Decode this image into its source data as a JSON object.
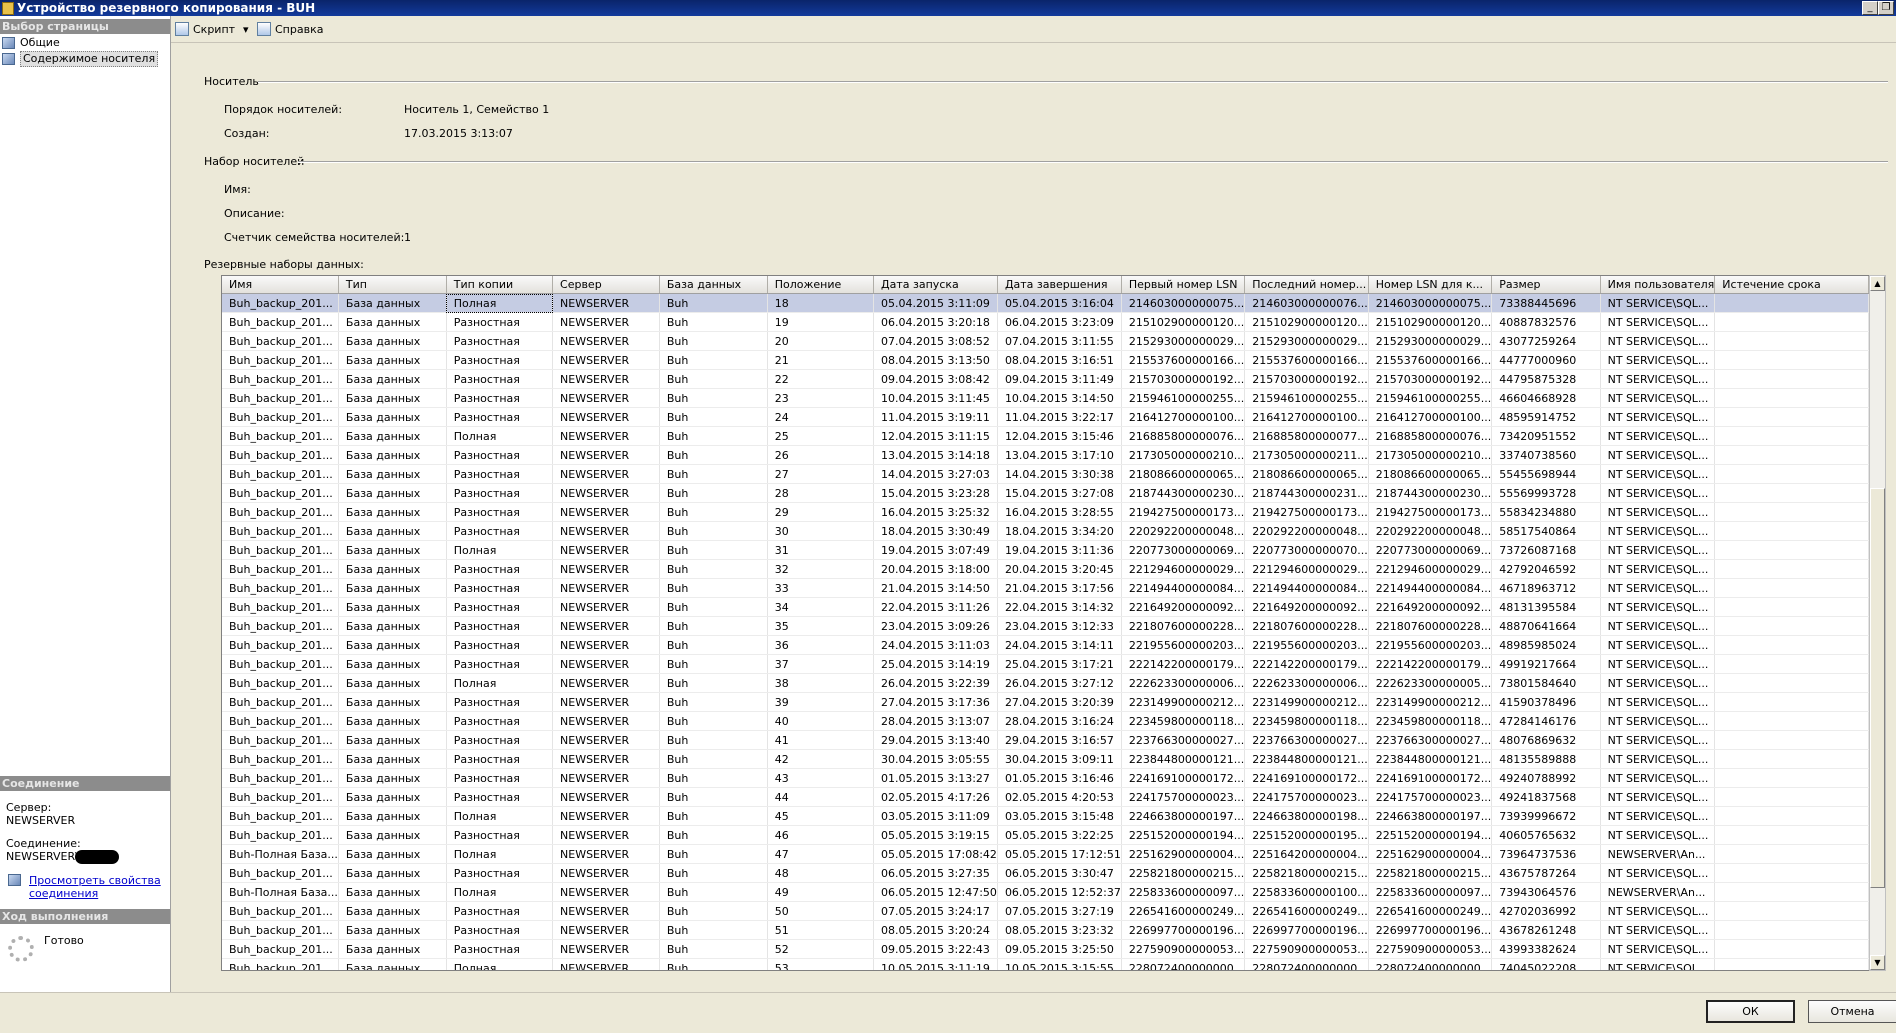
{
  "window": {
    "title": "Устройство резервного копирования - BUH",
    "minimize_glyph": "_",
    "restore_glyph": "❐"
  },
  "sidebar": {
    "page_select_header": "Выбор страницы",
    "items": [
      {
        "label": "Общие",
        "icon": "page-icon",
        "selected": false
      },
      {
        "label": "Содержимое носителя",
        "icon": "page-icon",
        "selected": true
      }
    ],
    "connection_header": "Соединение",
    "server_label": "Сервер:",
    "server_value": "NEWSERVER",
    "connection_label": "Соединение:",
    "connection_value": "NEWSERVER\\",
    "view_props_line1": "Просмотреть свойства",
    "view_props_line2": "соединения",
    "progress_header": "Ход выполнения",
    "progress_status": "Готово"
  },
  "toolbar": {
    "script_label": "Скрипт",
    "script_dropdown_glyph": "▾",
    "help_label": "Справка"
  },
  "media": {
    "section_title": "Носитель",
    "order_label": "Порядок носителей:",
    "order_value": "Носитель 1, Семейство 1",
    "created_label": "Создан:",
    "created_value": "17.03.2015 3:13:07"
  },
  "media_set": {
    "section_title": "Набор носителей",
    "name_label": "Имя:",
    "name_value": "",
    "description_label": "Описание:",
    "description_value": "",
    "family_count_label": "Счетчик семейства носителей:",
    "family_count_value": "1"
  },
  "backup_sets": {
    "label": "Резервные наборы данных:",
    "columns": [
      "Имя",
      "Тип",
      "Тип копии",
      "Сервер",
      "База данных",
      "Положение",
      "Дата запуска",
      "Дата завершения",
      "Первый номер LSN",
      "Последний номер...",
      "Номер LSN для к...",
      "Размер",
      "Имя пользователя",
      "Истечение срока"
    ],
    "rows": [
      [
        "Buh_backup_201...",
        "База данных",
        "Полная",
        "NEWSERVER",
        "Buh",
        "18",
        "05.04.2015 3:11:09",
        "05.04.2015 3:16:04",
        "214603000000075...",
        "214603000000076...",
        "214603000000075...",
        "73388445696",
        "NT SERVICE\\SQL...",
        ""
      ],
      [
        "Buh_backup_201...",
        "База данных",
        "Разностная",
        "NEWSERVER",
        "Buh",
        "19",
        "06.04.2015 3:20:18",
        "06.04.2015 3:23:09",
        "215102900000120...",
        "215102900000120...",
        "215102900000120...",
        "40887832576",
        "NT SERVICE\\SQL...",
        ""
      ],
      [
        "Buh_backup_201...",
        "База данных",
        "Разностная",
        "NEWSERVER",
        "Buh",
        "20",
        "07.04.2015 3:08:52",
        "07.04.2015 3:11:55",
        "215293000000029...",
        "215293000000029...",
        "215293000000029...",
        "43077259264",
        "NT SERVICE\\SQL...",
        ""
      ],
      [
        "Buh_backup_201...",
        "База данных",
        "Разностная",
        "NEWSERVER",
        "Buh",
        "21",
        "08.04.2015 3:13:50",
        "08.04.2015 3:16:51",
        "215537600000166...",
        "215537600000166...",
        "215537600000166...",
        "44777000960",
        "NT SERVICE\\SQL...",
        ""
      ],
      [
        "Buh_backup_201...",
        "База данных",
        "Разностная",
        "NEWSERVER",
        "Buh",
        "22",
        "09.04.2015 3:08:42",
        "09.04.2015 3:11:49",
        "215703000000192...",
        "215703000000192...",
        "215703000000192...",
        "44795875328",
        "NT SERVICE\\SQL...",
        ""
      ],
      [
        "Buh_backup_201...",
        "База данных",
        "Разностная",
        "NEWSERVER",
        "Buh",
        "23",
        "10.04.2015 3:11:45",
        "10.04.2015 3:14:50",
        "215946100000255...",
        "215946100000255...",
        "215946100000255...",
        "46604668928",
        "NT SERVICE\\SQL...",
        ""
      ],
      [
        "Buh_backup_201...",
        "База данных",
        "Разностная",
        "NEWSERVER",
        "Buh",
        "24",
        "11.04.2015 3:19:11",
        "11.04.2015 3:22:17",
        "216412700000100...",
        "216412700000100...",
        "216412700000100...",
        "48595914752",
        "NT SERVICE\\SQL...",
        ""
      ],
      [
        "Buh_backup_201...",
        "База данных",
        "Полная",
        "NEWSERVER",
        "Buh",
        "25",
        "12.04.2015 3:11:15",
        "12.04.2015 3:15:46",
        "216885800000076...",
        "216885800000077...",
        "216885800000076...",
        "73420951552",
        "NT SERVICE\\SQL...",
        ""
      ],
      [
        "Buh_backup_201...",
        "База данных",
        "Разностная",
        "NEWSERVER",
        "Buh",
        "26",
        "13.04.2015 3:14:18",
        "13.04.2015 3:17:10",
        "217305000000210...",
        "217305000000211...",
        "217305000000210...",
        "33740738560",
        "NT SERVICE\\SQL...",
        ""
      ],
      [
        "Buh_backup_201...",
        "База данных",
        "Разностная",
        "NEWSERVER",
        "Buh",
        "27",
        "14.04.2015 3:27:03",
        "14.04.2015 3:30:38",
        "218086600000065...",
        "218086600000065...",
        "218086600000065...",
        "55455698944",
        "NT SERVICE\\SQL...",
        ""
      ],
      [
        "Buh_backup_201...",
        "База данных",
        "Разностная",
        "NEWSERVER",
        "Buh",
        "28",
        "15.04.2015 3:23:28",
        "15.04.2015 3:27:08",
        "218744300000230...",
        "218744300000231...",
        "218744300000230...",
        "55569993728",
        "NT SERVICE\\SQL...",
        ""
      ],
      [
        "Buh_backup_201...",
        "База данных",
        "Разностная",
        "NEWSERVER",
        "Buh",
        "29",
        "16.04.2015 3:25:32",
        "16.04.2015 3:28:55",
        "219427500000173...",
        "219427500000173...",
        "219427500000173...",
        "55834234880",
        "NT SERVICE\\SQL...",
        ""
      ],
      [
        "Buh_backup_201...",
        "База данных",
        "Разностная",
        "NEWSERVER",
        "Buh",
        "30",
        "18.04.2015 3:30:49",
        "18.04.2015 3:34:20",
        "220292200000048...",
        "220292200000048...",
        "220292200000048...",
        "58517540864",
        "NT SERVICE\\SQL...",
        ""
      ],
      [
        "Buh_backup_201...",
        "База данных",
        "Полная",
        "NEWSERVER",
        "Buh",
        "31",
        "19.04.2015 3:07:49",
        "19.04.2015 3:11:36",
        "220773000000069...",
        "220773000000070...",
        "220773000000069...",
        "73726087168",
        "NT SERVICE\\SQL...",
        ""
      ],
      [
        "Buh_backup_201...",
        "База данных",
        "Разностная",
        "NEWSERVER",
        "Buh",
        "32",
        "20.04.2015 3:18:00",
        "20.04.2015 3:20:45",
        "221294600000029...",
        "221294600000029...",
        "221294600000029...",
        "42792046592",
        "NT SERVICE\\SQL...",
        ""
      ],
      [
        "Buh_backup_201...",
        "База данных",
        "Разностная",
        "NEWSERVER",
        "Buh",
        "33",
        "21.04.2015 3:14:50",
        "21.04.2015 3:17:56",
        "221494400000084...",
        "221494400000084...",
        "221494400000084...",
        "46718963712",
        "NT SERVICE\\SQL...",
        ""
      ],
      [
        "Buh_backup_201...",
        "База данных",
        "Разностная",
        "NEWSERVER",
        "Buh",
        "34",
        "22.04.2015 3:11:26",
        "22.04.2015 3:14:32",
        "221649200000092...",
        "221649200000092...",
        "221649200000092...",
        "48131395584",
        "NT SERVICE\\SQL...",
        ""
      ],
      [
        "Buh_backup_201...",
        "База данных",
        "Разностная",
        "NEWSERVER",
        "Buh",
        "35",
        "23.04.2015 3:09:26",
        "23.04.2015 3:12:33",
        "221807600000228...",
        "221807600000228...",
        "221807600000228...",
        "48870641664",
        "NT SERVICE\\SQL...",
        ""
      ],
      [
        "Buh_backup_201...",
        "База данных",
        "Разностная",
        "NEWSERVER",
        "Buh",
        "36",
        "24.04.2015 3:11:03",
        "24.04.2015 3:14:11",
        "221955600000203...",
        "221955600000203...",
        "221955600000203...",
        "48985985024",
        "NT SERVICE\\SQL...",
        ""
      ],
      [
        "Buh_backup_201...",
        "База данных",
        "Разностная",
        "NEWSERVER",
        "Buh",
        "37",
        "25.04.2015 3:14:19",
        "25.04.2015 3:17:21",
        "222142200000179...",
        "222142200000179...",
        "222142200000179...",
        "49919217664",
        "NT SERVICE\\SQL...",
        ""
      ],
      [
        "Buh_backup_201...",
        "База данных",
        "Полная",
        "NEWSERVER",
        "Buh",
        "38",
        "26.04.2015 3:22:39",
        "26.04.2015 3:27:12",
        "222623300000006...",
        "222623300000006...",
        "222623300000005...",
        "73801584640",
        "NT SERVICE\\SQL...",
        ""
      ],
      [
        "Buh_backup_201...",
        "База данных",
        "Разностная",
        "NEWSERVER",
        "Buh",
        "39",
        "27.04.2015 3:17:36",
        "27.04.2015 3:20:39",
        "223149900000212...",
        "223149900000212...",
        "223149900000212...",
        "41590378496",
        "NT SERVICE\\SQL...",
        ""
      ],
      [
        "Buh_backup_201...",
        "База данных",
        "Разностная",
        "NEWSERVER",
        "Buh",
        "40",
        "28.04.2015 3:13:07",
        "28.04.2015 3:16:24",
        "223459800000118...",
        "223459800000118...",
        "223459800000118...",
        "47284146176",
        "NT SERVICE\\SQL...",
        ""
      ],
      [
        "Buh_backup_201...",
        "База данных",
        "Разностная",
        "NEWSERVER",
        "Buh",
        "41",
        "29.04.2015 3:13:40",
        "29.04.2015 3:16:57",
        "223766300000027...",
        "223766300000027...",
        "223766300000027...",
        "48076869632",
        "NT SERVICE\\SQL...",
        ""
      ],
      [
        "Buh_backup_201...",
        "База данных",
        "Разностная",
        "NEWSERVER",
        "Buh",
        "42",
        "30.04.2015 3:05:55",
        "30.04.2015 3:09:11",
        "223844800000121...",
        "223844800000121...",
        "223844800000121...",
        "48135589888",
        "NT SERVICE\\SQL...",
        ""
      ],
      [
        "Buh_backup_201...",
        "База данных",
        "Разностная",
        "NEWSERVER",
        "Buh",
        "43",
        "01.05.2015 3:13:27",
        "01.05.2015 3:16:46",
        "224169100000172...",
        "224169100000172...",
        "224169100000172...",
        "49240788992",
        "NT SERVICE\\SQL...",
        ""
      ],
      [
        "Buh_backup_201...",
        "База данных",
        "Разностная",
        "NEWSERVER",
        "Buh",
        "44",
        "02.05.2015 4:17:26",
        "02.05.2015 4:20:53",
        "224175700000023...",
        "224175700000023...",
        "224175700000023...",
        "49241837568",
        "NT SERVICE\\SQL...",
        ""
      ],
      [
        "Buh_backup_201...",
        "База данных",
        "Полная",
        "NEWSERVER",
        "Buh",
        "45",
        "03.05.2015 3:11:09",
        "03.05.2015 3:15:48",
        "224663800000197...",
        "224663800000198...",
        "224663800000197...",
        "73939996672",
        "NT SERVICE\\SQL...",
        ""
      ],
      [
        "Buh_backup_201...",
        "База данных",
        "Разностная",
        "NEWSERVER",
        "Buh",
        "46",
        "05.05.2015 3:19:15",
        "05.05.2015 3:22:25",
        "225152000000194...",
        "225152000000195...",
        "225152000000194...",
        "40605765632",
        "NT SERVICE\\SQL...",
        ""
      ],
      [
        "Buh-Полная База...",
        "База данных",
        "Полная",
        "NEWSERVER",
        "Buh",
        "47",
        "05.05.2015 17:08:42",
        "05.05.2015 17:12:51",
        "225162900000004...",
        "225164200000004...",
        "225162900000004...",
        "73964737536",
        "NEWSERVER\\An...",
        ""
      ],
      [
        "Buh_backup_201...",
        "База данных",
        "Разностная",
        "NEWSERVER",
        "Buh",
        "48",
        "06.05.2015 3:27:35",
        "06.05.2015 3:30:47",
        "225821800000215...",
        "225821800000215...",
        "225821800000215...",
        "43675787264",
        "NT SERVICE\\SQL...",
        ""
      ],
      [
        "Buh-Полная База...",
        "База данных",
        "Полная",
        "NEWSERVER",
        "Buh",
        "49",
        "06.05.2015 12:47:50",
        "06.05.2015 12:52:37",
        "225833600000097...",
        "225833600000100...",
        "225833600000097...",
        "73943064576",
        "NEWSERVER\\An...",
        ""
      ],
      [
        "Buh_backup_201...",
        "База данных",
        "Разностная",
        "NEWSERVER",
        "Buh",
        "50",
        "07.05.2015 3:24:17",
        "07.05.2015 3:27:19",
        "226541600000249...",
        "226541600000249...",
        "226541600000249...",
        "42702036992",
        "NT SERVICE\\SQL...",
        ""
      ],
      [
        "Buh_backup_201...",
        "База данных",
        "Разностная",
        "NEWSERVER",
        "Buh",
        "51",
        "08.05.2015 3:20:24",
        "08.05.2015 3:23:32",
        "226997700000196...",
        "226997700000196...",
        "226997700000196...",
        "43678261248",
        "NT SERVICE\\SQL...",
        ""
      ],
      [
        "Buh_backup_201...",
        "База данных",
        "Разностная",
        "NEWSERVER",
        "Buh",
        "52",
        "09.05.2015 3:22:43",
        "09.05.2015 3:25:50",
        "227590900000053...",
        "227590900000053...",
        "227590900000053...",
        "43993382624",
        "NT SERVICE\\SQL...",
        ""
      ],
      [
        "Buh_backup_201...",
        "База данных",
        "Полная",
        "NEWSERVER",
        "Buh",
        "53",
        "10.05.2015 3:11:19",
        "10.05.2015 3:15:55",
        "228072400000000...",
        "228072400000000...",
        "228072400000000...",
        "74045022208",
        "NT SERVICE\\SQL...",
        ""
      ]
    ],
    "selected_row": 0
  },
  "scrollbar": {
    "up_glyph": "▲",
    "down_glyph": "▼"
  },
  "buttons": {
    "ok": "ОК",
    "cancel": "Отмена"
  }
}
